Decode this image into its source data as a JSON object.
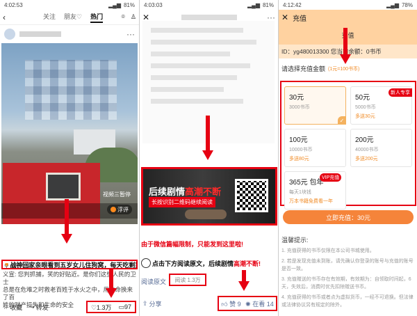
{
  "panel1": {
    "status": {
      "time": "4:02:53",
      "battery": "81%"
    },
    "nav": {
      "tabs": [
        "关注",
        "朋友♡",
        "热门"
      ],
      "active": 2
    },
    "photo": {
      "video_tag": "视频三暂停",
      "float_button": "浮评",
      "location": "保定市"
    },
    "title": "战神回家亲眼看到五岁女儿住狗窝，每天吃剩菜！",
    "body_lines": [
      "义宣: 您判抓捕，笑的好贴近。是你们这些人民的卫士",
      "总是在危难之时救老百姓于水火之中，用生命换来了百",
      "姓的财产损失和生命的安全"
    ],
    "actions": {
      "favorite": "收藏",
      "share": "转发"
    },
    "counts": {
      "likes": "1.3万",
      "comments": "97"
    }
  },
  "panel2": {
    "status": {
      "time": "4:03:03",
      "battery": "81%"
    },
    "ad": {
      "title_a": "后续剧情",
      "title_b": "高潮不断",
      "subtitle": "长按识别二维码继续阅读"
    },
    "notice": "由于微信篇幅限制，只能发到这里啦!",
    "cta_a": "点击下方阅读原文，后续剧情",
    "cta_b": "高潮不断!",
    "read_original": "阅读原文",
    "read_count": "阅读 1.3万",
    "share": "分享",
    "like": "赞 9",
    "watching": "在看 14"
  },
  "panel3": {
    "status": {
      "time": "4:12:42",
      "battery": "78%"
    },
    "header_title": "充值",
    "sub_title": "充值",
    "account_line": "ID：yg480013300  您当前余额：0书币",
    "choose_label": "请选择充值金额",
    "rate": "(1元=100书币)",
    "options": [
      {
        "price": "30元",
        "coins": "3000书币",
        "bonus": "",
        "tag": "",
        "selected": true
      },
      {
        "price": "50元",
        "coins": "5000书币",
        "bonus": "多送30元",
        "tag": "新人专享",
        "selected": false
      },
      {
        "price": "100元",
        "coins": "10000书币",
        "bonus": "多送80元",
        "tag": "",
        "selected": false
      },
      {
        "price": "200元",
        "coins": "40000书币",
        "bonus": "多送200元",
        "tag": "",
        "selected": false
      },
      {
        "price": "365元 包年",
        "coins": "每天1块钱",
        "bonus": "万本书籍免费看一年",
        "tag": "VIP充值",
        "selected": false
      }
    ],
    "pay_button": "立即充值：30元",
    "tips_head": "温馨提示:",
    "tips": [
      "1. 充值获得的书币仅限在本公司书城使用。",
      "2. 若是发现充值未到账，请先确认你登录的账号与充值的账号是否一致。",
      "3. 充值赠送的书币存在有效期，有效期为：自领取时间起，6天，失效后，消费时优先扣除赠送书币。",
      "4. 充值获得的书币或者点为虚拟货币，一经不可退换。但法律或法律协议另有规定的除外。"
    ]
  }
}
